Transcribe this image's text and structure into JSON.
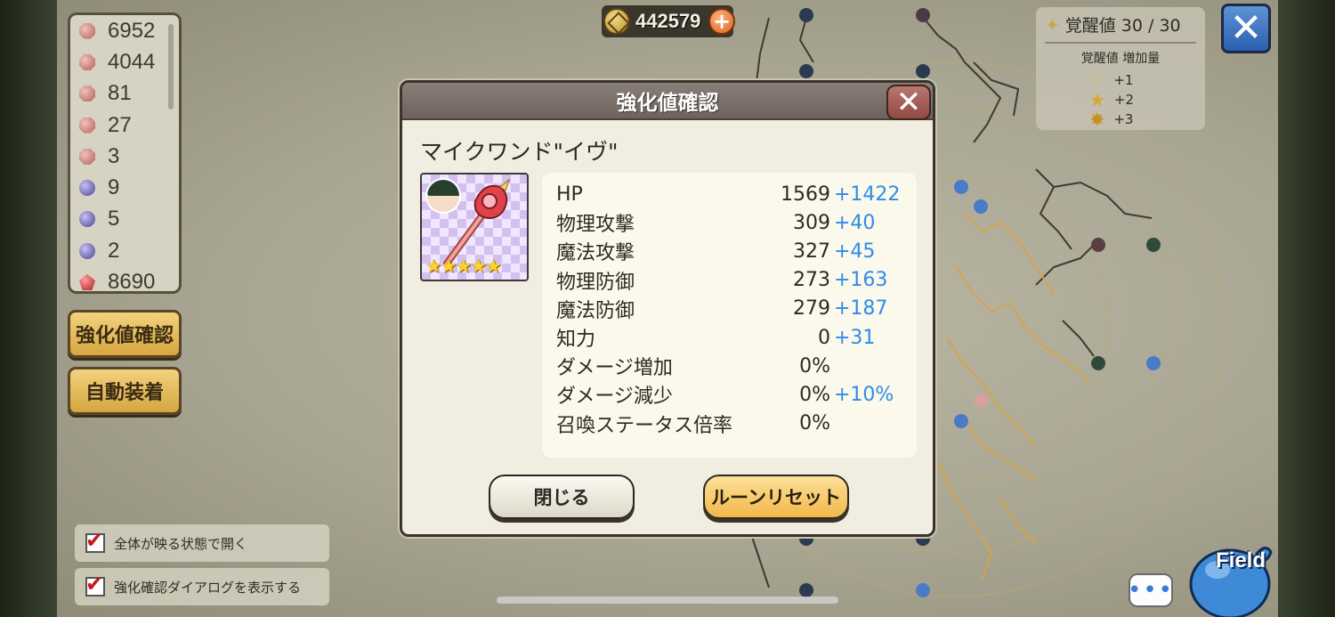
{
  "currency": {
    "amount": "442579",
    "plus_icon": "plus-icon"
  },
  "materials": [
    {
      "icon": "gem-red-icon",
      "count": "6952"
    },
    {
      "icon": "gem-red-icon",
      "count": "4044"
    },
    {
      "icon": "gem-red-icon",
      "count": "81"
    },
    {
      "icon": "gem-red-icon",
      "count": "27"
    },
    {
      "icon": "gem-red-icon",
      "count": "3"
    },
    {
      "icon": "gem-purple-icon",
      "count": "9"
    },
    {
      "icon": "gem-purple-icon",
      "count": "5"
    },
    {
      "icon": "gem-purple-icon",
      "count": "2"
    },
    {
      "icon": "gem-ruby-icon",
      "count": "8690"
    }
  ],
  "side_buttons": {
    "enhance_check": "強化値確認",
    "auto_equip": "自動装着"
  },
  "options": [
    {
      "label": "全体が映る状態で開く",
      "checked": true
    },
    {
      "label": "強化確認ダイアログを表示する",
      "checked": true
    }
  ],
  "awakening": {
    "title": "覚醒値 30 / 30",
    "subtitle": "覚醒値 増加量",
    "levels": [
      "+1",
      "+2",
      "+3"
    ]
  },
  "dialog": {
    "title": "強化値確認",
    "item_name": "マイクワンド\"イヴ\"",
    "rarity_stars": "★★★★★",
    "stats": [
      {
        "label": "HP",
        "value": "1569",
        "bonus": "+1422"
      },
      {
        "label": "物理攻撃",
        "value": "309",
        "bonus": "+40"
      },
      {
        "label": "魔法攻撃",
        "value": "327",
        "bonus": "+45"
      },
      {
        "label": "物理防御",
        "value": "273",
        "bonus": "+163"
      },
      {
        "label": "魔法防御",
        "value": "279",
        "bonus": "+187"
      },
      {
        "label": "知力",
        "value": "0",
        "bonus": "+31"
      },
      {
        "label": "ダメージ増加",
        "value": "0%",
        "bonus": ""
      },
      {
        "label": "ダメージ減少",
        "value": "0%",
        "bonus": "+10%"
      },
      {
        "label": "召喚ステータス倍率",
        "value": "0%",
        "bonus": ""
      }
    ],
    "close_button": "閉じる",
    "reset_button": "ルーンリセット"
  },
  "field_button": "Field",
  "chat_icon": "chat-bubble-icon",
  "colors": {
    "bonus_blue": "#2e8ce8",
    "button_gold": "#f0b84a"
  }
}
